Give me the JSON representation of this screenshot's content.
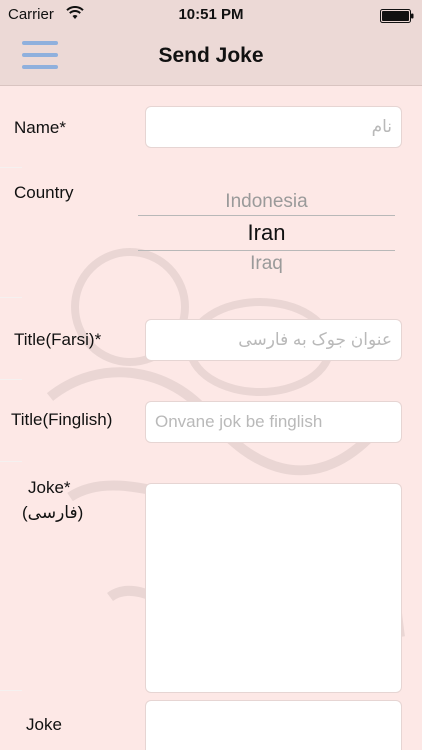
{
  "status_bar": {
    "carrier": "Carrier",
    "time": "10:51 PM"
  },
  "nav": {
    "title": "Send Joke",
    "menu_icon": "hamburger-menu-icon"
  },
  "form": {
    "name": {
      "label": "Name*",
      "placeholder": "نام"
    },
    "country": {
      "label": "Country",
      "options_visible": [
        "Indonesia",
        "Iran",
        "Iraq"
      ],
      "selected": "Iran"
    },
    "title_farsi": {
      "label": "Title(Farsi)*",
      "placeholder": "عنوان جوک به فارسی"
    },
    "title_finglish": {
      "label": "Title(Finglish)",
      "placeholder": "Onvane jok be finglish"
    },
    "joke_farsi": {
      "label_line1": "Joke*",
      "label_line2": "(فارسی)"
    },
    "joke_finglish": {
      "label": "Joke"
    }
  },
  "colors": {
    "background": "#fde8e6",
    "bar": "#ecd9d6",
    "menu_icon": "#8fb0dd"
  }
}
